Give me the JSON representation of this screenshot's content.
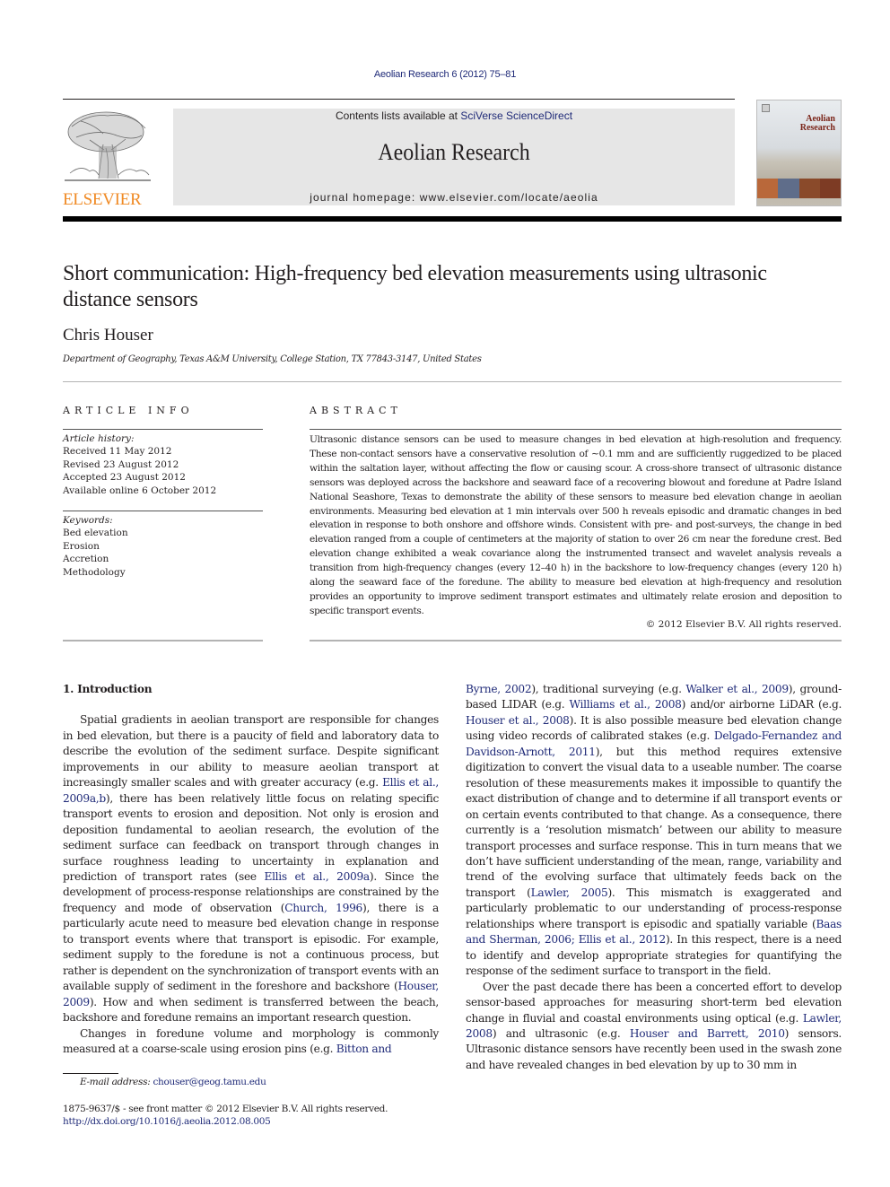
{
  "header": {
    "journal_reference": "Aeolian Research 6 (2012) 75–81",
    "contents_prefix": "Contents lists available at ",
    "contents_link": "SciVerse ScienceDirect",
    "journal_title": "Aeolian Research",
    "homepage": "journal homepage: www.elsevier.com/locate/aeolia",
    "publisher_logo_text": "ELSEVIER",
    "cover_title_line1": "Aeolian",
    "cover_title_line2": "Research"
  },
  "colors": {
    "link": "#1f2a78",
    "publisher_orange": "#f08a24",
    "masthead_bg": "#e6e6e6"
  },
  "article": {
    "title": "Short communication: High-frequency bed elevation measurements using ultrasonic distance sensors",
    "author": "Chris Houser",
    "affiliation": "Department of Geography, Texas A&M University, College Station, TX 77843-3147, United States"
  },
  "article_info": {
    "heading": "ARTICLE INFO",
    "history_label": "Article history:",
    "history": [
      "Received 11 May 2012",
      "Revised 23 August 2012",
      "Accepted 23 August 2012",
      "Available online 6 October 2012"
    ],
    "keywords_label": "Keywords:",
    "keywords": [
      "Bed elevation",
      "Erosion",
      "Accretion",
      "Methodology"
    ]
  },
  "abstract": {
    "heading": "ABSTRACT",
    "text": "Ultrasonic distance sensors can be used to measure changes in bed elevation at high-resolution and frequency. These non-contact sensors have a conservative resolution of ∼0.1 mm and are sufficiently ruggedized to be placed within the saltation layer, without affecting the flow or causing scour. A cross-shore transect of ultrasonic distance sensors was deployed across the backshore and seaward face of a recovering blowout and foredune at Padre Island National Seashore, Texas to demonstrate the ability of these sensors to measure bed elevation change in aeolian environments. Measuring bed elevation at 1 min intervals over 500 h reveals episodic and dramatic changes in bed elevation in response to both onshore and offshore winds. Consistent with pre- and post-surveys, the change in bed elevation ranged from a couple of centimeters at the majority of station to over 26 cm near the foredune crest. Bed elevation change exhibited a weak covariance along the instrumented transect and wavelet analysis reveals a transition from high-frequency changes (every 12–40 h) in the backshore to low-frequency changes (every 120 h) along the seaward face of the foredune. The ability to measure bed elevation at high-frequency and resolution provides an opportunity to improve sediment transport estimates and ultimately relate erosion and deposition to specific transport events.",
    "copyright": "© 2012 Elsevier B.V. All rights reserved."
  },
  "body": {
    "section_heading": "1. Introduction",
    "p1": [
      {
        "t": "Spatial gradients in aeolian transport are responsible for changes in bed elevation, but there is a paucity of field and laboratory data to describe the evolution of the sediment surface. Despite significant improvements in our ability to measure aeolian transport at increasingly smaller scales and with greater accuracy (e.g. "
      },
      {
        "ref": "Ellis et al., 2009a,b"
      },
      {
        "t": "), there has been relatively little focus on relating specific transport events to erosion and deposition. Not only is erosion and deposition fundamental to aeolian research, the evolution of the sediment surface can feedback on transport through changes in surface roughness leading to uncertainty in explanation and prediction of transport rates (see "
      },
      {
        "ref": "Ellis et al., 2009a"
      },
      {
        "t": "). Since the development of process-response relationships are constrained by the frequency and mode of observation ("
      },
      {
        "ref": "Church, 1996"
      },
      {
        "t": "), there is a particularly acute need to measure bed elevation change in response to transport events where that transport is episodic. For example, sediment supply to the foredune is not a continuous process, but rather is dependent on the synchronization of transport events with an available supply of sediment in the foreshore and backshore ("
      },
      {
        "ref": "Houser, 2009"
      },
      {
        "t": "). How and when sediment is transferred between the beach, backshore and foredune remains an important research question."
      }
    ],
    "p2_left": [
      {
        "t": "Changes in foredune volume and morphology is commonly measured at a coarse-scale using erosion pins (e.g. "
      },
      {
        "ref": "Bitton and"
      }
    ],
    "p2_right": [
      {
        "ref": "Byrne, 2002"
      },
      {
        "t": "), traditional surveying (e.g. "
      },
      {
        "ref": "Walker et al., 2009"
      },
      {
        "t": "), ground-based LIDAR (e.g. "
      },
      {
        "ref": "Williams et al., 2008"
      },
      {
        "t": ") and/or airborne LiDAR (e.g. "
      },
      {
        "ref": "Houser et al., 2008"
      },
      {
        "t": "). It is also possible measure bed elevation change using video records of calibrated stakes (e.g. "
      },
      {
        "ref": "Delgado-Fernandez and Davidson-Arnott, 2011"
      },
      {
        "t": "), but this method requires extensive digitization to convert the visual data to a useable number. The coarse resolution of these measurements makes it impossible to quantify the exact distribution of change and to determine if all transport events or on certain events contributed to that change. As a consequence, there currently is a ‘resolution mismatch’ between our ability to measure transport processes and surface response. This in turn means that we don’t have sufficient understanding of the mean, range, variability and trend of the evolving surface that ultimately feeds back on the transport ("
      },
      {
        "ref": "Lawler, 2005"
      },
      {
        "t": "). This mismatch is exaggerated and particularly problematic to our understanding of process-response relationships where transport is episodic and spatially variable ("
      },
      {
        "ref": "Baas and Sherman, 2006; Ellis et al., 2012"
      },
      {
        "t": "). In this respect, there is a need to identify and develop appropriate strategies for quantifying the response of the sediment surface to transport in the field."
      }
    ],
    "p3": [
      {
        "t": "Over the past decade there has been a concerted effort to develop sensor-based approaches for measuring short-term bed elevation change in fluvial and coastal environments using optical (e.g. "
      },
      {
        "ref": "Lawler, 2008"
      },
      {
        "t": ") and ultrasonic (e.g. "
      },
      {
        "ref": "Houser and Barrett, 2010"
      },
      {
        "t": ") sensors. Ultrasonic distance sensors have recently been used in the swash zone and have revealed changes in bed elevation by up to 30 mm in"
      }
    ]
  },
  "footer": {
    "email_label": "E-mail address: ",
    "email": "chouser@geog.tamu.edu",
    "issn_line": "1875-9637/$ - see front matter © 2012 Elsevier B.V. All rights reserved.",
    "doi": "http://dx.doi.org/10.1016/j.aeolia.2012.08.005"
  }
}
